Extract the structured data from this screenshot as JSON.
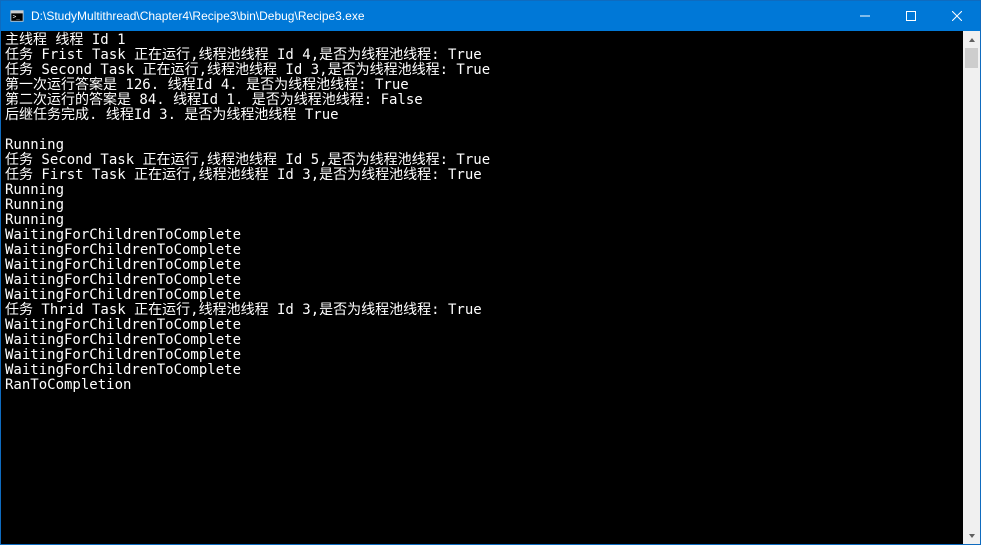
{
  "window": {
    "title": "D:\\StudyMultithread\\Chapter4\\Recipe3\\bin\\Debug\\Recipe3.exe"
  },
  "console": {
    "lines": [
      "主线程 线程 Id 1",
      "任务 Frist Task 正在运行,线程池线程 Id 4,是否为线程池线程: True",
      "任务 Second Task 正在运行,线程池线程 Id 3,是否为线程池线程: True",
      "第一次运行答案是 126. 线程Id 4. 是否为线程池线程: True",
      "第二次运行的答案是 84. 线程Id 1. 是否为线程池线程: False",
      "后继任务完成. 线程Id 3. 是否为线程池线程 True",
      "",
      "Running",
      "任务 Second Task 正在运行,线程池线程 Id 5,是否为线程池线程: True",
      "任务 First Task 正在运行,线程池线程 Id 3,是否为线程池线程: True",
      "Running",
      "Running",
      "Running",
      "WaitingForChildrenToComplete",
      "WaitingForChildrenToComplete",
      "WaitingForChildrenToComplete",
      "WaitingForChildrenToComplete",
      "WaitingForChildrenToComplete",
      "任务 Thrid Task 正在运行,线程池线程 Id 3,是否为线程池线程: True",
      "WaitingForChildrenToComplete",
      "WaitingForChildrenToComplete",
      "WaitingForChildrenToComplete",
      "WaitingForChildrenToComplete",
      "RanToCompletion"
    ]
  }
}
